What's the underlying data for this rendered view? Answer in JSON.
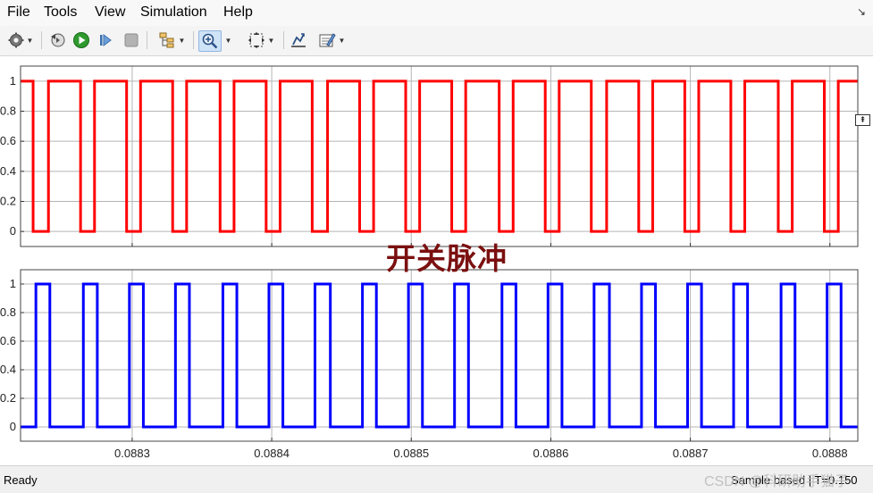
{
  "menu": {
    "items": [
      "File",
      "Tools",
      "View",
      "Simulation",
      "Help"
    ]
  },
  "toolbar": {
    "icons": [
      "settings-icon",
      "restore-icon",
      "run-icon",
      "step-forward-icon",
      "stop-icon",
      "signal-hierarchy-icon",
      "zoom-in-icon",
      "zoom-to-fit-icon",
      "scale-axes-icon",
      "edit-properties-icon"
    ]
  },
  "overlay": {
    "title": "开关脉冲"
  },
  "status": {
    "left": "Ready",
    "right": "Sample based | T=0.150",
    "watermark": "CSDN @科研助手猫子"
  },
  "colors": {
    "series1": "#ff0000",
    "series2": "#0000ff"
  },
  "chart_data": [
    {
      "type": "line",
      "x_range": [
        0.08822,
        0.08882
      ],
      "ylim": [
        -0.1,
        1.1
      ],
      "yticks": [
        0,
        0.2,
        0.4,
        0.6,
        0.8,
        1
      ],
      "ytick_labels": [
        "0",
        "0.2",
        "0.4",
        "0.6",
        "0.8",
        "1"
      ],
      "xticks": [
        0.0883,
        0.0884,
        0.0885,
        0.0886,
        0.0887,
        0.0888
      ],
      "grid": true,
      "color": "#ff0000",
      "series": [
        {
          "type": "step",
          "initial": 1,
          "transitions": [
            [
              0.088229,
              0
            ],
            [
              0.08824,
              1
            ],
            [
              0.088263,
              0
            ],
            [
              0.088273,
              1
            ],
            [
              0.088296,
              0
            ],
            [
              0.088306,
              1
            ],
            [
              0.088329,
              0
            ],
            [
              0.088339,
              1
            ],
            [
              0.088363,
              0
            ],
            [
              0.088373,
              1
            ],
            [
              0.088396,
              0
            ],
            [
              0.088406,
              1
            ],
            [
              0.088429,
              0
            ],
            [
              0.08844,
              1
            ],
            [
              0.088463,
              0
            ],
            [
              0.088473,
              1
            ],
            [
              0.088496,
              0
            ],
            [
              0.088506,
              1
            ],
            [
              0.088529,
              0
            ],
            [
              0.088539,
              1
            ],
            [
              0.088563,
              0
            ],
            [
              0.088573,
              1
            ],
            [
              0.088596,
              0
            ],
            [
              0.088606,
              1
            ],
            [
              0.088629,
              0
            ],
            [
              0.08864,
              1
            ],
            [
              0.088663,
              0
            ],
            [
              0.088673,
              1
            ],
            [
              0.088696,
              0
            ],
            [
              0.088706,
              1
            ],
            [
              0.088729,
              0
            ],
            [
              0.088739,
              1
            ],
            [
              0.088763,
              0
            ],
            [
              0.088773,
              1
            ],
            [
              0.088796,
              0
            ],
            [
              0.088806,
              1
            ]
          ]
        }
      ]
    },
    {
      "type": "line",
      "x_range": [
        0.08822,
        0.08882
      ],
      "ylim": [
        -0.1,
        1.1
      ],
      "yticks": [
        0,
        0.2,
        0.4,
        0.6,
        0.8,
        1
      ],
      "ytick_labels": [
        "0",
        "0.2",
        "0.4",
        "0.6",
        "0.8",
        "1"
      ],
      "xticks": [
        0.0883,
        0.0884,
        0.0885,
        0.0886,
        0.0887,
        0.0888
      ],
      "xtick_labels": [
        "0.0883",
        "0.0884",
        "0.0885",
        "0.0886",
        "0.0887",
        "0.0888"
      ],
      "grid": true,
      "color": "#0000ff",
      "series": [
        {
          "type": "step",
          "initial": 0,
          "transitions": [
            [
              0.088231,
              1
            ],
            [
              0.088241,
              0
            ],
            [
              0.088265,
              1
            ],
            [
              0.088275,
              0
            ],
            [
              0.088298,
              1
            ],
            [
              0.088308,
              0
            ],
            [
              0.088331,
              1
            ],
            [
              0.088341,
              0
            ],
            [
              0.088365,
              1
            ],
            [
              0.088375,
              0
            ],
            [
              0.088398,
              1
            ],
            [
              0.088408,
              0
            ],
            [
              0.088431,
              1
            ],
            [
              0.088442,
              0
            ],
            [
              0.088465,
              1
            ],
            [
              0.088475,
              0
            ],
            [
              0.088498,
              1
            ],
            [
              0.088508,
              0
            ],
            [
              0.088531,
              1
            ],
            [
              0.088541,
              0
            ],
            [
              0.088565,
              1
            ],
            [
              0.088575,
              0
            ],
            [
              0.088598,
              1
            ],
            [
              0.088608,
              0
            ],
            [
              0.088631,
              1
            ],
            [
              0.088642,
              0
            ],
            [
              0.088665,
              1
            ],
            [
              0.088675,
              0
            ],
            [
              0.088698,
              1
            ],
            [
              0.088708,
              0
            ],
            [
              0.088731,
              1
            ],
            [
              0.088741,
              0
            ],
            [
              0.088765,
              1
            ],
            [
              0.088775,
              0
            ],
            [
              0.088798,
              1
            ],
            [
              0.088808,
              0
            ]
          ]
        }
      ]
    }
  ]
}
